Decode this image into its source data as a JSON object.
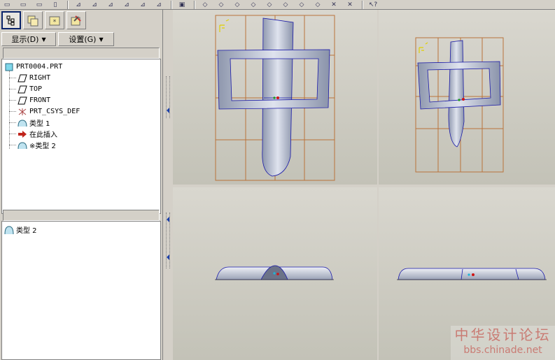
{
  "toolbar": {
    "icons": [
      "open-icon",
      "save-icon",
      "copy-icon",
      "sketch-icon",
      "datum-plane-icon",
      "datum-axis-icon",
      "datum-point-icon",
      "csys-icon",
      "view-icon",
      "spin-icon",
      "shade-icon",
      "wireframe-icon",
      "hidden-line-icon",
      "no-hidden-icon",
      "orient-icon",
      "repaint-icon",
      "delete-icon",
      "what-this-icon"
    ]
  },
  "left_panel": {
    "tabs": [
      {
        "name": "model-tree-tab",
        "icon": "model-tree-icon",
        "active": true
      },
      {
        "name": "folder-browser-tab",
        "icon": "folder-icon",
        "active": false
      },
      {
        "name": "favorites-tab",
        "icon": "favorites-icon",
        "active": false
      },
      {
        "name": "connections-tab",
        "icon": "connections-icon",
        "active": false
      }
    ],
    "display_menu": {
      "label": "显示(D)"
    },
    "settings_menu": {
      "label": "设置(G)"
    },
    "tree": {
      "root": "PRT0004.PRT",
      "items": [
        {
          "label": "RIGHT",
          "icon": "datum-plane-icon"
        },
        {
          "label": "TOP",
          "icon": "datum-plane-icon"
        },
        {
          "label": "FRONT",
          "icon": "datum-plane-icon"
        },
        {
          "label": "PRT_CSYS_DEF",
          "icon": "csys-icon"
        },
        {
          "label": "类型 1",
          "icon": "style-feature-icon"
        },
        {
          "label": "在此插入",
          "icon": "insert-arrow-icon"
        },
        {
          "label": "※类型 2",
          "icon": "style-feature-icon"
        }
      ]
    },
    "detail": {
      "items": [
        {
          "label": "类型 2",
          "icon": "style-feature-icon"
        }
      ]
    }
  },
  "viewports": [
    {
      "name": "viewport-top-left",
      "orientation": "front"
    },
    {
      "name": "viewport-top-right",
      "orientation": "default"
    },
    {
      "name": "viewport-bottom-left",
      "orientation": "top"
    },
    {
      "name": "viewport-bottom-right",
      "orientation": "side"
    }
  ],
  "watermark": {
    "line1": "中华设计论坛",
    "line2": "bbs.chinade.net"
  },
  "colors": {
    "viewport_bg": "#cfcdc5",
    "grid": "#b9733b",
    "model": "#b9c0d0",
    "model_edge": "#1a1aa8",
    "watermark": "#c97b73"
  }
}
